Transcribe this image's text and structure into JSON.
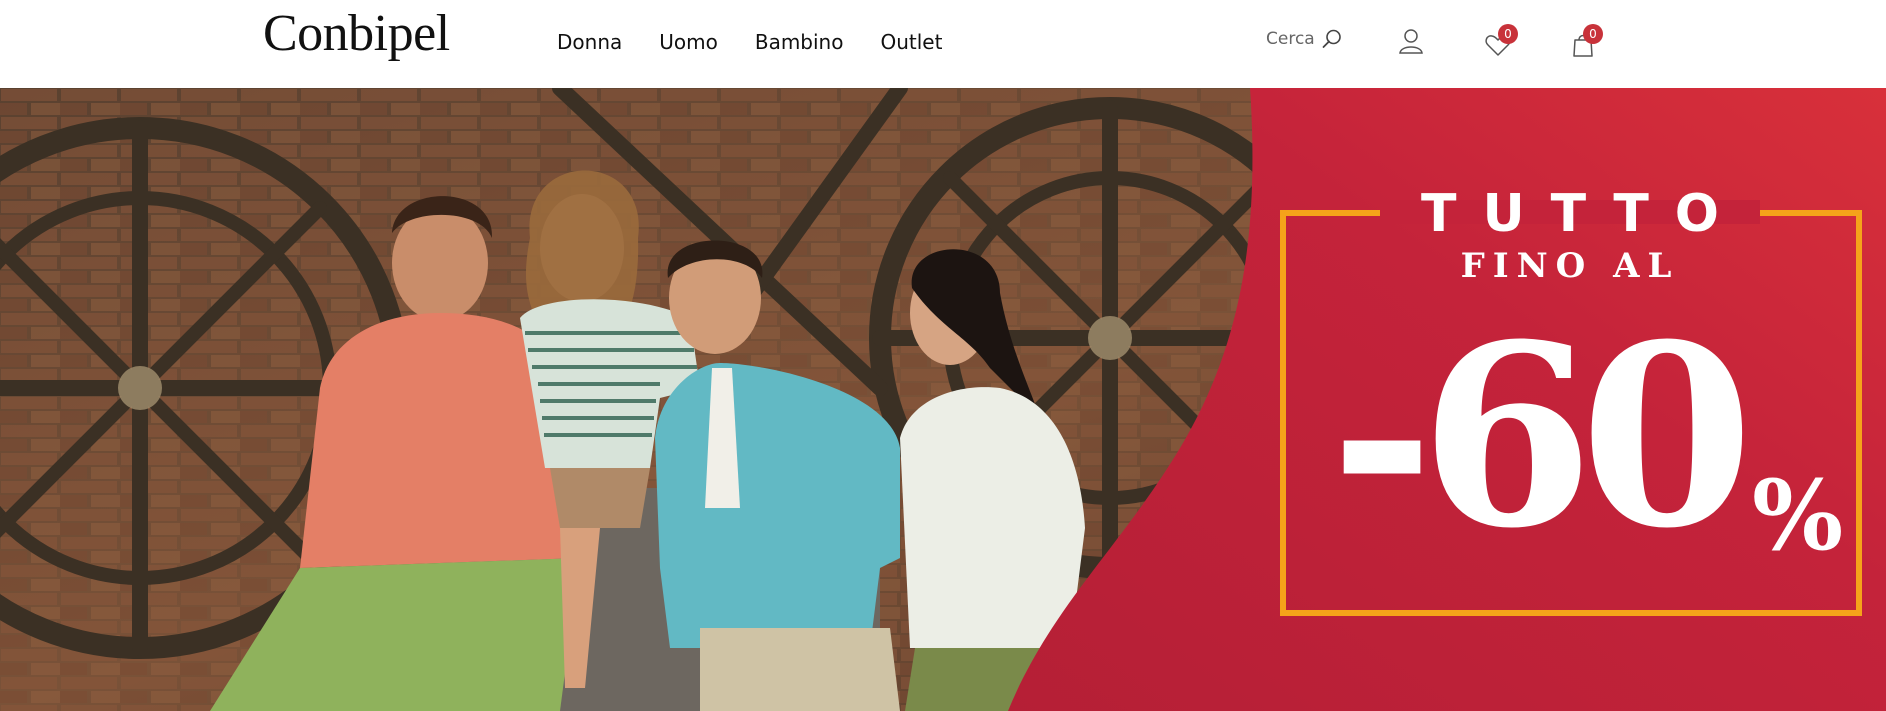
{
  "header": {
    "logo": "Conbipel",
    "nav": [
      "Donna",
      "Uomo",
      "Bambino",
      "Outlet"
    ],
    "search_label": "Cerca",
    "wishlist_count": "0",
    "cart_count": "0",
    "icons": [
      "search-icon",
      "user-icon",
      "heart-icon",
      "bag-icon"
    ]
  },
  "hero": {
    "headline": "TUTTO",
    "subline": "FINO AL",
    "discount": "-60",
    "percent_sign": "%",
    "colors": {
      "promo_red": "#c4233a",
      "frame_orange": "#f5a31a",
      "badge_red": "#c8323a"
    }
  }
}
